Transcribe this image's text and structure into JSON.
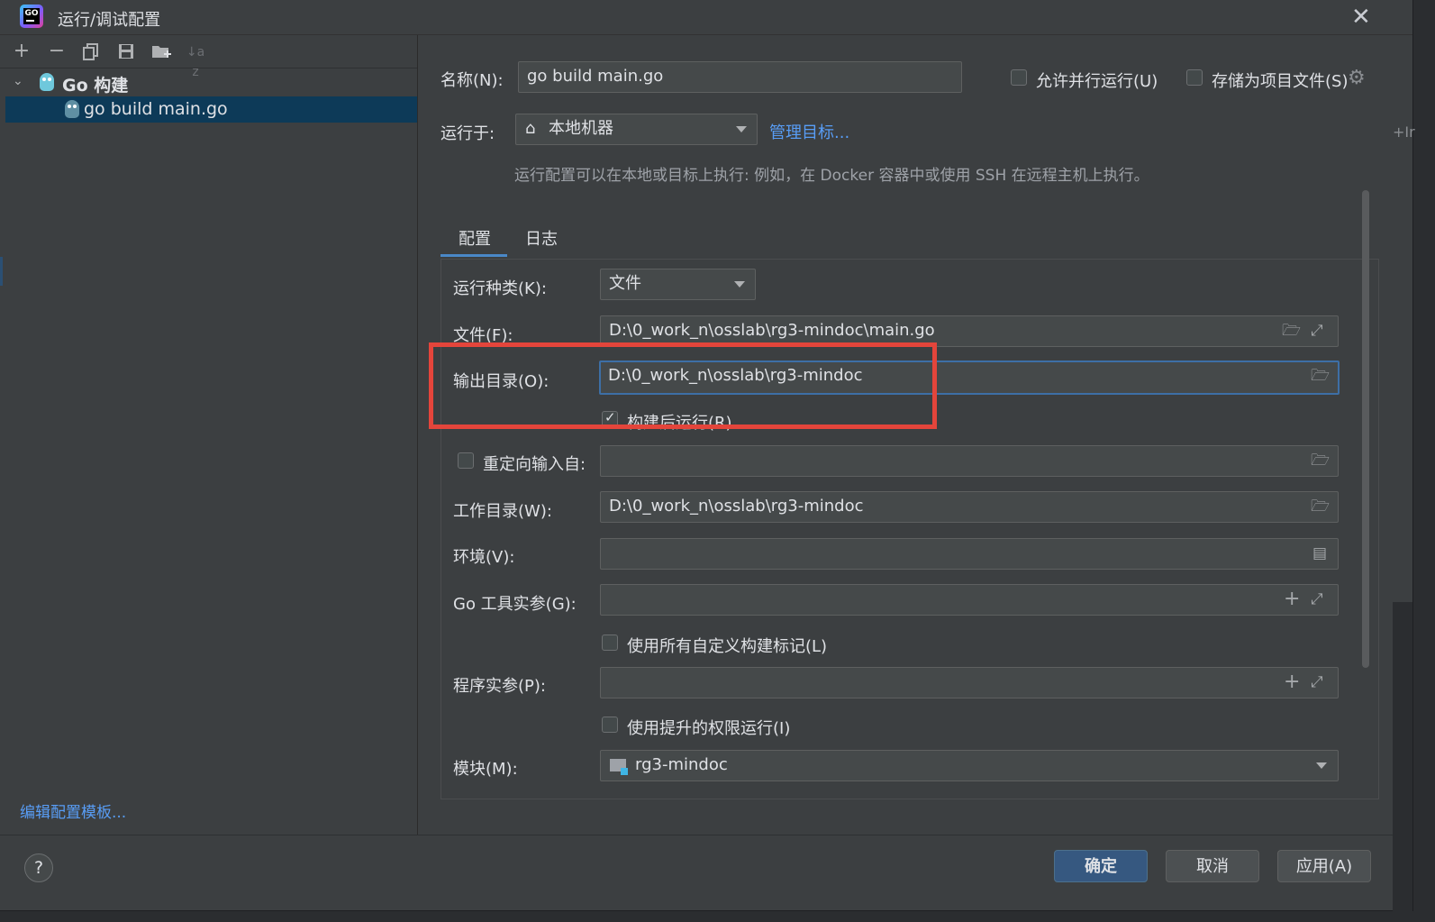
{
  "window": {
    "title": "运行/调试配置",
    "logo_text": "GO"
  },
  "toolbar": {
    "add_icon": "plus-icon",
    "remove_icon": "minus-icon",
    "copy_icon": "copy-icon",
    "save_icon": "save-icon",
    "folder_icon": "new-folder-icon",
    "sort_icon": "sort-alpha-icon",
    "sort_label": "↓a z"
  },
  "tree": {
    "group_label": "Go 构建",
    "item_label": "go build main.go"
  },
  "left": {
    "edit_templates": "编辑配置模板..."
  },
  "header": {
    "name_label": "名称(N):",
    "name_value": "go build main.go",
    "allow_parallel": "允许并行运行(U)",
    "store_as_file": "存储为项目文件(S)",
    "run_on_label": "运行于:",
    "run_on_value": "本地机器",
    "manage_targets": "管理目标...",
    "hint": "运行配置可以在本地或目标上执行: 例如，在 Docker 容器中或使用 SSH 在远程主机上执行。"
  },
  "tabs": [
    {
      "label": "配置"
    },
    {
      "label": "日志"
    }
  ],
  "form": {
    "run_kind_label": "运行种类(K):",
    "run_kind_value": "文件",
    "file_label": "文件(F):",
    "file_value": "D:\\0_work_n\\osslab\\rg3-mindoc\\main.go",
    "output_label": "输出目录(O):",
    "output_value": "D:\\0_work_n\\osslab\\rg3-mindoc",
    "run_after_build": "构建后运行(R)",
    "run_after_build_checked": true,
    "redirect_label": "重定向输入自:",
    "redirect_value": "",
    "workdir_label": "工作目录(W):",
    "workdir_value": "D:\\0_work_n\\osslab\\rg3-mindoc",
    "env_label": "环境(V):",
    "env_value": "",
    "go_tool_label": "Go 工具实参(G):",
    "go_tool_value": "",
    "custom_tags": "使用所有自定义构建标记(L)",
    "program_args_label": "程序实参(P):",
    "program_args_value": "",
    "elevated": "使用提升的权限运行(I)",
    "module_label": "模块(M):",
    "module_value": "rg3-mindoc"
  },
  "footer": {
    "help": "?",
    "ok": "确定",
    "cancel": "取消",
    "apply": "应用(A)"
  },
  "edge": {
    "text": "+Ir"
  },
  "colors": {
    "accent": "#589df6",
    "selection": "#0d3a58",
    "highlight_border": "#e4453b",
    "primary_button": "#365880"
  }
}
